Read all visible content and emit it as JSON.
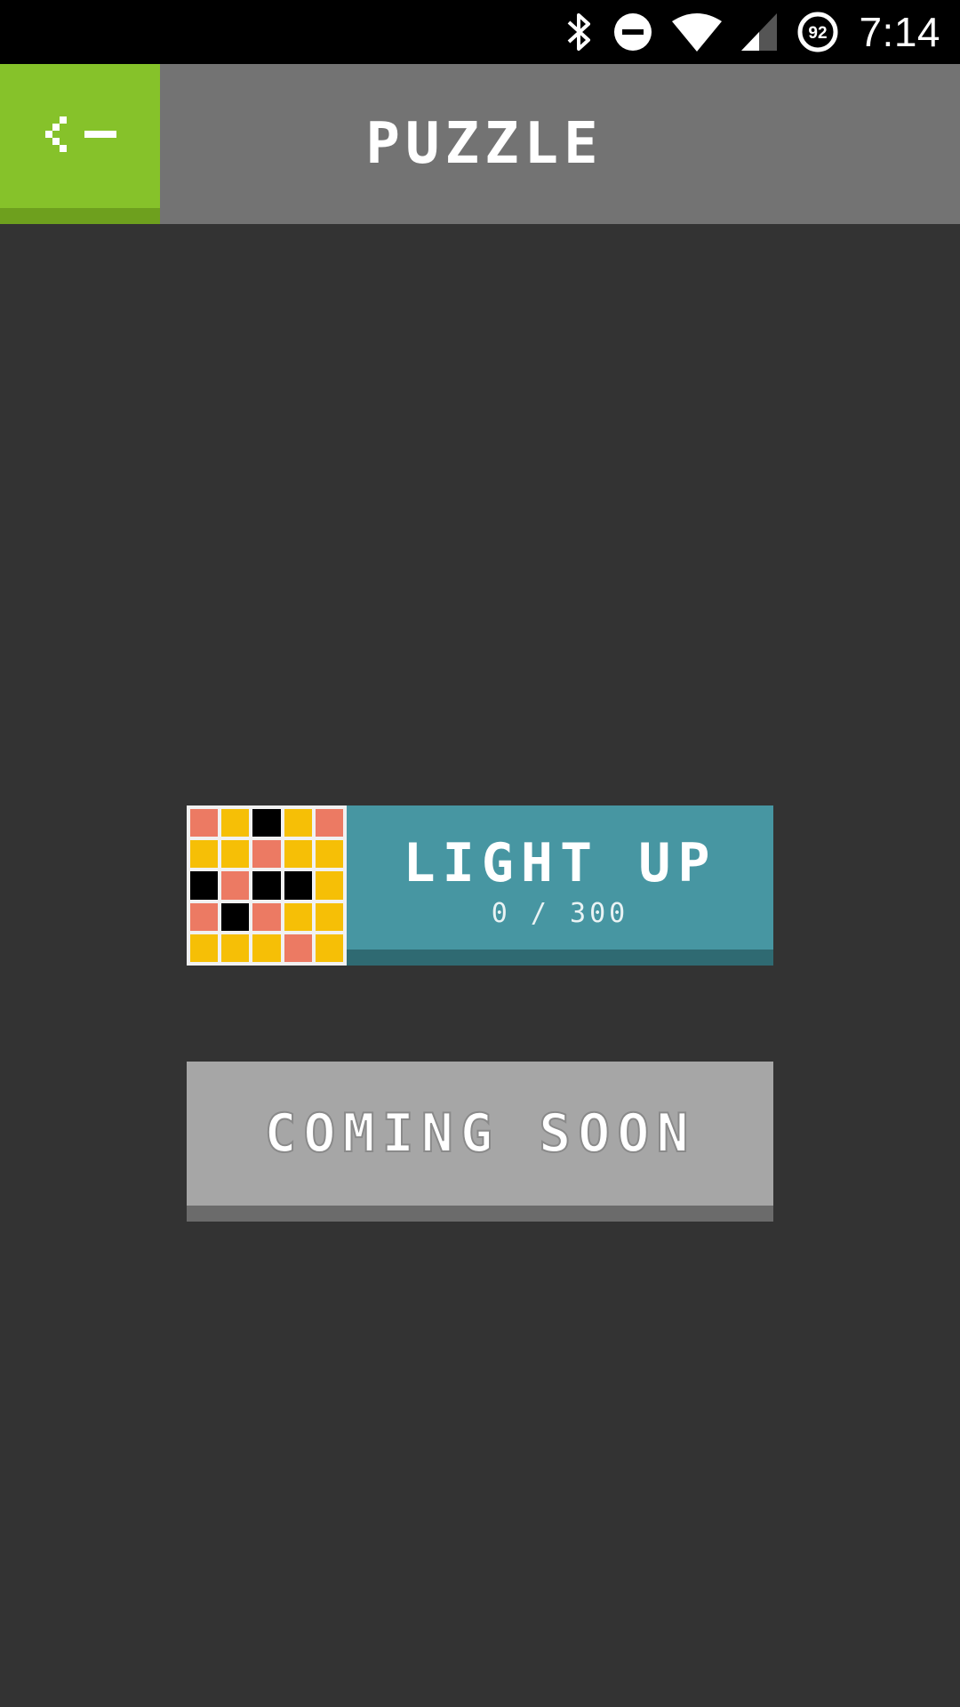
{
  "status_bar": {
    "time": "7:14",
    "battery_level": "92",
    "icons": [
      "bluetooth-icon",
      "do-not-disturb-icon",
      "wifi-icon",
      "cell-signal-icon",
      "battery-icon"
    ]
  },
  "header": {
    "back_icon": "back-arrow-icon",
    "title": "PUZZLE"
  },
  "puzzles": [
    {
      "name": "LIGHT UP",
      "progress": "0 / 300",
      "thumbnail_grid": [
        [
          "salmon",
          "yellow",
          "black",
          "yellow",
          "salmon"
        ],
        [
          "yellow",
          "yellow",
          "salmon",
          "yellow",
          "yellow"
        ],
        [
          "black",
          "salmon",
          "black",
          "black",
          "yellow"
        ],
        [
          "salmon",
          "black",
          "salmon",
          "yellow",
          "yellow"
        ],
        [
          "yellow",
          "yellow",
          "yellow",
          "salmon",
          "yellow"
        ]
      ]
    }
  ],
  "coming_soon": {
    "label": "COMING SOON"
  },
  "colors": {
    "background": "#333333",
    "header": "#737373",
    "accent_green": "#86c22a",
    "card_teal": "#4796a2",
    "card_gray": "#a6a6a6",
    "salmon": "#ec7a63",
    "yellow": "#f6bf06",
    "black": "#000000"
  }
}
